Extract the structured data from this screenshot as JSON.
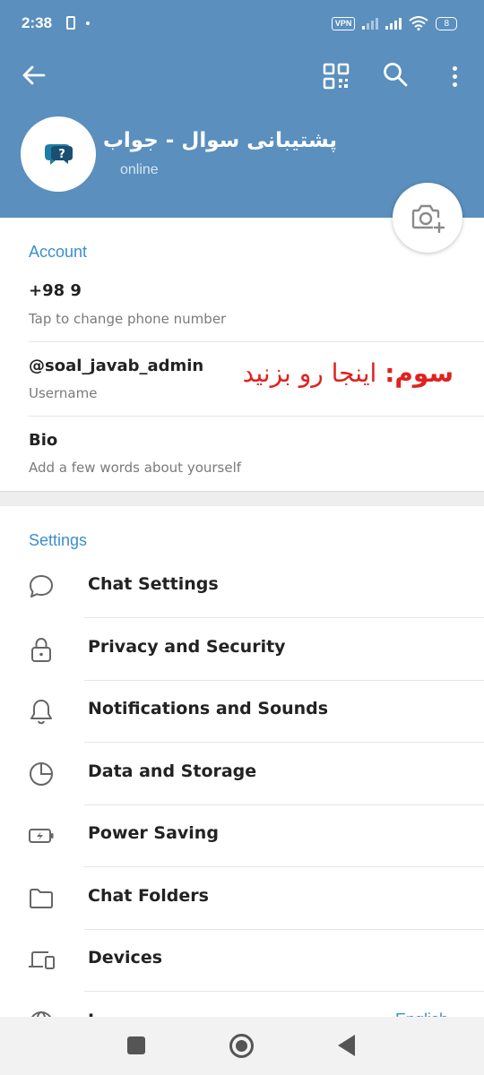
{
  "status_bar": {
    "time": "2:38",
    "vpn": "VPN",
    "battery": "8"
  },
  "profile": {
    "name": "پشتیبانی سوال - جواب",
    "status": "online"
  },
  "account": {
    "title": "Account",
    "phone": "+98 9",
    "phone_hint": "Tap to change phone number",
    "username": "@soal_javab_admin",
    "username_hint": "Username",
    "bio": "Bio",
    "bio_hint": "Add a few words about yourself"
  },
  "annotation": {
    "prefix": "سوم:",
    "text": "اینجا رو بزنید"
  },
  "settings": {
    "title": "Settings",
    "items": [
      {
        "label": "Chat Settings",
        "icon": "chat-bubble-icon"
      },
      {
        "label": "Privacy and Security",
        "icon": "lock-icon"
      },
      {
        "label": "Notifications and Sounds",
        "icon": "bell-icon"
      },
      {
        "label": "Data and Storage",
        "icon": "pie-chart-icon"
      },
      {
        "label": "Power Saving",
        "icon": "battery-bolt-icon"
      },
      {
        "label": "Chat Folders",
        "icon": "folder-icon"
      },
      {
        "label": "Devices",
        "icon": "devices-icon"
      },
      {
        "label": "L",
        "icon": "globe-icon",
        "value": "English"
      }
    ]
  },
  "colors": {
    "header": "#5a8fbe",
    "accent": "#3a8fcf",
    "annotation": "#e0221e"
  }
}
